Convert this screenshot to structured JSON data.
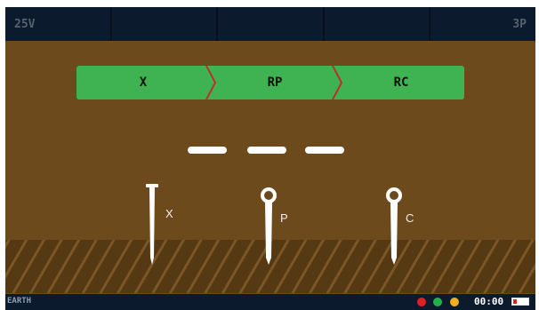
{
  "topbar": {
    "cells": [
      "25V",
      "",
      "",
      "",
      "3P"
    ]
  },
  "steps": [
    "X",
    "RP",
    "RC"
  ],
  "colors": {
    "step_fill": "#3fb351",
    "step_separator": "#b8322b",
    "background": "#6c4a1c",
    "bar": "#0b1a2c"
  },
  "reading": {
    "display": "– – –"
  },
  "probes": [
    {
      "label": "X",
      "type": "nail"
    },
    {
      "label": "P",
      "type": "ring-stake"
    },
    {
      "label": "C",
      "type": "ring-stake"
    }
  ],
  "status": {
    "mode": "EARTH",
    "indicators": [
      {
        "name": "red-indicator",
        "color": "#e02020"
      },
      {
        "name": "green-indicator",
        "color": "#1fb34a"
      },
      {
        "name": "yellow-indicator",
        "color": "#f0b020"
      }
    ],
    "time": "00:00",
    "battery_level": 0.25
  }
}
